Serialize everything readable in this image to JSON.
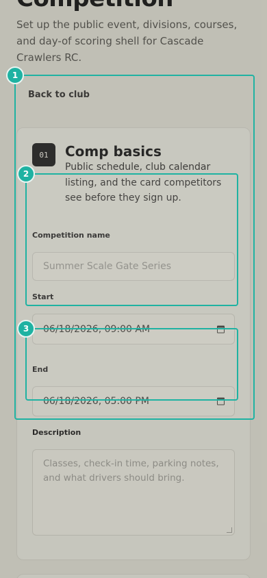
{
  "header": {
    "title": "Competition",
    "intro": "Set up the public event, divisions, courses, and day-of scoring shell for Cascade Crawlers RC."
  },
  "nav": {
    "back_label": "Back to club"
  },
  "section": {
    "step": "01",
    "title": "Comp basics",
    "description": "Public schedule, club calendar listing, and the card competitors see before they sign up."
  },
  "fields": {
    "name_label": "Competition name",
    "name_placeholder": "Summer Scale Gate Series",
    "start_label": "Start",
    "start_value": "06/18/2026, 09:00 AM",
    "end_label": "End",
    "end_value": "06/18/2026, 05:00 PM",
    "description_label": "Description",
    "description_placeholder": "Classes, check-in time, parking notes, and what drivers should bring."
  },
  "annotations": [
    "1",
    "2",
    "3"
  ],
  "colors": {
    "highlight": "#1fb2a2",
    "background": "#c8c7bb"
  }
}
